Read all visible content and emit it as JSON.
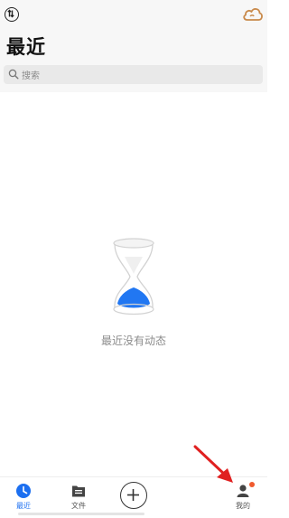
{
  "header": {
    "title": "最近",
    "search_placeholder": "搜索",
    "sync_icon": "sync-icon",
    "cloud_icon": "cloud-icon"
  },
  "empty_state": {
    "icon": "hourglass-icon",
    "message": "最近没有动态"
  },
  "nav": {
    "items": [
      {
        "label": "最近",
        "icon": "clock-icon",
        "active": true
      },
      {
        "label": "文件",
        "icon": "folder-icon",
        "active": false
      },
      {
        "label": "",
        "icon": "add-icon",
        "active": false
      },
      {
        "label": "我的",
        "icon": "person-icon",
        "active": false
      }
    ]
  },
  "colors": {
    "accent": "#1c6ff0",
    "badge": "#f05a2e",
    "cloud": "#c98a4b",
    "hourglass_fill": "#2177f2",
    "annotation_arrow": "#e02020"
  }
}
